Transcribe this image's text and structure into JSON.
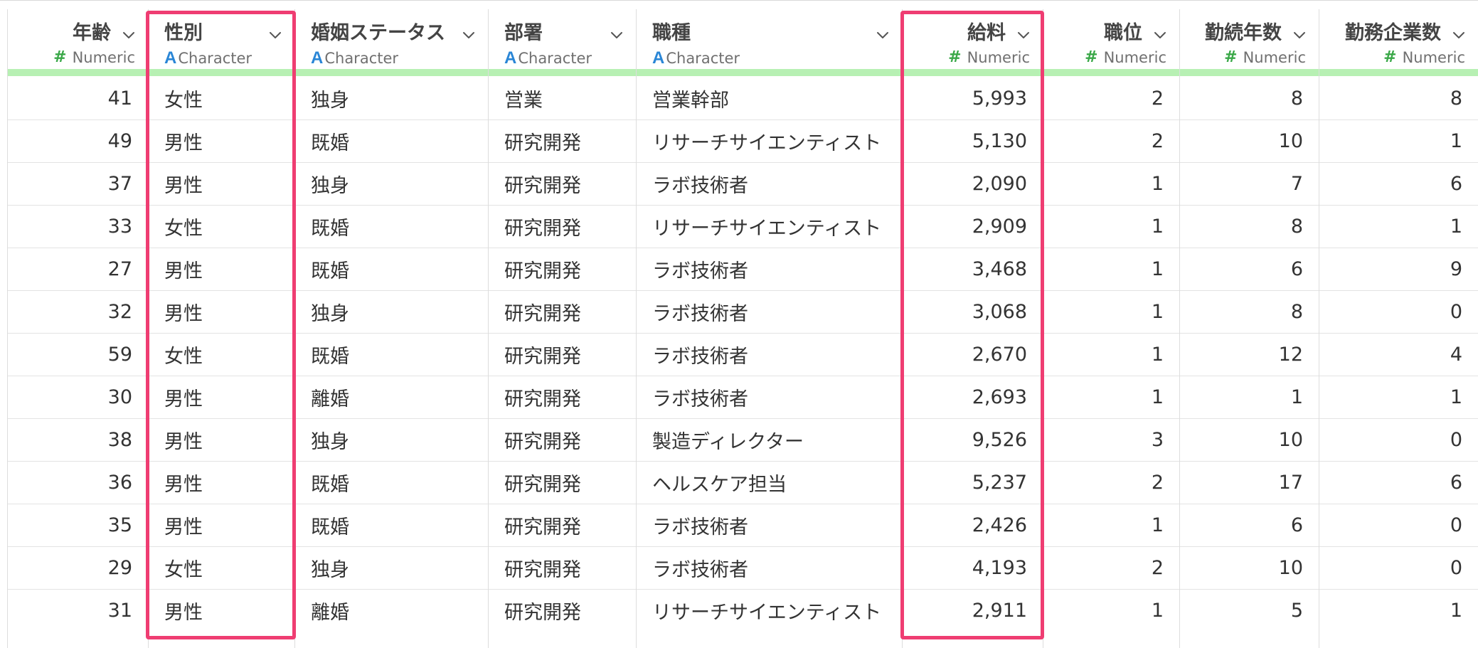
{
  "table": {
    "columns": [
      {
        "key": "age",
        "title": "年齢",
        "type": "Numeric"
      },
      {
        "key": "gender",
        "title": "性別",
        "type": "Character"
      },
      {
        "key": "marital",
        "title": "婚姻ステータス",
        "type": "Character"
      },
      {
        "key": "department",
        "title": "部署",
        "type": "Character"
      },
      {
        "key": "job",
        "title": "職種",
        "type": "Character"
      },
      {
        "key": "salary",
        "title": "給料",
        "type": "Numeric"
      },
      {
        "key": "level",
        "title": "職位",
        "type": "Numeric"
      },
      {
        "key": "years",
        "title": "勤続年数",
        "type": "Numeric"
      },
      {
        "key": "companies",
        "title": "勤務企業数",
        "type": "Numeric"
      }
    ],
    "rows": [
      [
        "41",
        "女性",
        "独身",
        "営業",
        "営業幹部",
        "5,993",
        "2",
        "8",
        "8"
      ],
      [
        "49",
        "男性",
        "既婚",
        "研究開発",
        "リサーチサイエンティスト",
        "5,130",
        "2",
        "10",
        "1"
      ],
      [
        "37",
        "男性",
        "独身",
        "研究開発",
        "ラボ技術者",
        "2,090",
        "1",
        "7",
        "6"
      ],
      [
        "33",
        "女性",
        "既婚",
        "研究開発",
        "リサーチサイエンティスト",
        "2,909",
        "1",
        "8",
        "1"
      ],
      [
        "27",
        "男性",
        "既婚",
        "研究開発",
        "ラボ技術者",
        "3,468",
        "1",
        "6",
        "9"
      ],
      [
        "32",
        "男性",
        "独身",
        "研究開発",
        "ラボ技術者",
        "3,068",
        "1",
        "8",
        "0"
      ],
      [
        "59",
        "女性",
        "既婚",
        "研究開発",
        "ラボ技術者",
        "2,670",
        "1",
        "12",
        "4"
      ],
      [
        "30",
        "男性",
        "離婚",
        "研究開発",
        "ラボ技術者",
        "2,693",
        "1",
        "1",
        "1"
      ],
      [
        "38",
        "男性",
        "独身",
        "研究開発",
        "製造ディレクター",
        "9,526",
        "3",
        "10",
        "0"
      ],
      [
        "36",
        "男性",
        "既婚",
        "研究開発",
        "ヘルスケア担当",
        "5,237",
        "2",
        "17",
        "6"
      ],
      [
        "35",
        "男性",
        "既婚",
        "研究開発",
        "ラボ技術者",
        "2,426",
        "1",
        "6",
        "0"
      ],
      [
        "29",
        "女性",
        "独身",
        "研究開発",
        "ラボ技術者",
        "4,193",
        "2",
        "10",
        "0"
      ],
      [
        "31",
        "男性",
        "離婚",
        "研究開発",
        "リサーチサイエンティスト",
        "2,911",
        "1",
        "5",
        "1"
      ]
    ]
  },
  "colors": {
    "highlight": "#ef3d72",
    "numeric_icon": "#3aa848",
    "character_icon": "#2a86d6",
    "quality_bar": "#b7f0b3"
  },
  "icons": {
    "numeric": "hash-icon",
    "character": "letter-a-icon",
    "menu": "chevron-down-icon"
  }
}
